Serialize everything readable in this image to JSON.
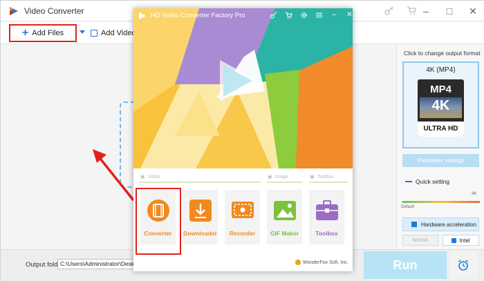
{
  "back_window": {
    "title": "Video Converter",
    "toolbar": {
      "add_files": "Add Files",
      "add_folder": "Add Video Fol"
    },
    "right_panel": {
      "hint": "Click to change output format",
      "format_name": "4K (MP4)",
      "format_icon": {
        "top": "MP4",
        "mid": "4K",
        "bottom": "ULTRA HD"
      },
      "param_settings": "Parameter settings",
      "quick_setting": "Quick setting",
      "slider_max": "4K",
      "slider_default": "Default",
      "hw_accel": "Hardware acceleration",
      "nvidia": "NVIDIA",
      "intel": "Intel"
    },
    "bottom": {
      "output_label": "Output folder:",
      "output_path": "C:\\Users\\Administrator\\Desktop",
      "run": "Run"
    }
  },
  "front_window": {
    "title": "HD Video Converter Factory Pro",
    "sections": {
      "video": "Video",
      "image": "Image",
      "toolbox": "Toolbox"
    },
    "tiles": [
      {
        "label": "Converter",
        "color": "#f08a1e"
      },
      {
        "label": "Downloader",
        "color": "#f08a1e"
      },
      {
        "label": "Recorder",
        "color": "#f08a1e"
      },
      {
        "label": "GIF Maker",
        "color": "#7cc23c"
      },
      {
        "label": "Toolbox",
        "color": "#9d6ac4"
      }
    ],
    "footer": "WonderFox Soft, Inc."
  },
  "colors": {
    "highlight_red": "#e0211a",
    "accent_blue": "#1e7ad8",
    "run_blue": "#b7e3f7"
  }
}
